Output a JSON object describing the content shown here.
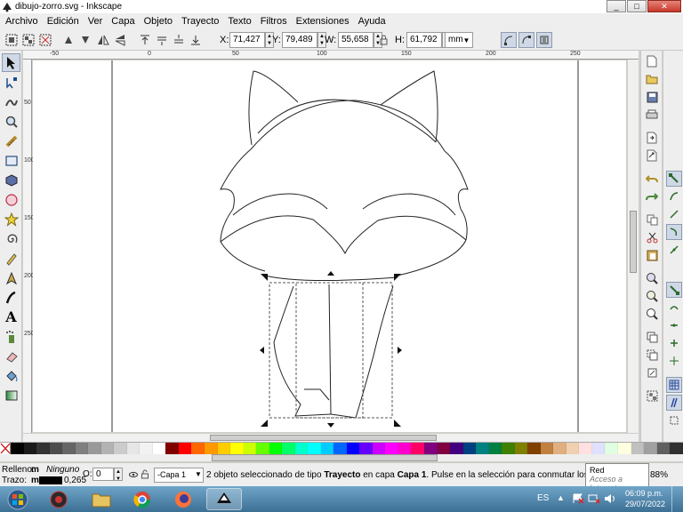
{
  "window": {
    "title": "dibujo-zorro.svg - Inkscape",
    "minimize": "_",
    "maximize": "□",
    "close": "✕"
  },
  "menu": [
    "Archivo",
    "Edición",
    "Ver",
    "Capa",
    "Objeto",
    "Trayecto",
    "Texto",
    "Filtros",
    "Extensiones",
    "Ayuda"
  ],
  "toolbar": {
    "x_label": "X:",
    "x_value": "71,427",
    "y_label": "Y:",
    "y_value": "79,489",
    "w_label": "W:",
    "w_value": "55,658",
    "h_label": "H:",
    "h_value": "61,792",
    "unit": "mm"
  },
  "status": {
    "fill_label": "Relleno:",
    "fill_flag": "m",
    "fill_value": "Ninguno",
    "stroke_label": "Trazo:",
    "stroke_flag": "m",
    "stroke_width": "0,265",
    "opacity_label": "O:",
    "opacity_value": "0",
    "layer": "-Capa 1",
    "message_a": "2 objeto seleccionado de tipo ",
    "message_b": "Trayecto",
    "message_c": " en capa ",
    "message_d": "Capa 1",
    "message_e": ". Pulse en la selección para conmutar los tiradores d...",
    "zoom": "88%"
  },
  "tooltip": {
    "title": "Red",
    "subtitle": "Acceso a Internet"
  },
  "taskbar": {
    "lang": "ES",
    "time": "06:09 p.m.",
    "date": "29/07/2022"
  },
  "colors": {
    "palette": [
      "#000000",
      "#1a1a1a",
      "#333333",
      "#4d4d4d",
      "#666666",
      "#808080",
      "#999999",
      "#b3b3b3",
      "#cccccc",
      "#e6e6e6",
      "#f2f2f2",
      "#ffffff",
      "#800000",
      "#ff0000",
      "#ff6600",
      "#ff9900",
      "#ffcc00",
      "#ffff00",
      "#ccff00",
      "#66ff00",
      "#00ff00",
      "#00ff66",
      "#00ffcc",
      "#00ffff",
      "#00ccff",
      "#0066ff",
      "#0000ff",
      "#6600ff",
      "#cc00ff",
      "#ff00ff",
      "#ff00cc",
      "#ff0066",
      "#800080",
      "#800040",
      "#400080",
      "#004080",
      "#008080",
      "#008040",
      "#408000",
      "#808000",
      "#804000",
      "#c08040",
      "#e0b080",
      "#f0d0b0",
      "#ffe0e0",
      "#e0e0ff",
      "#e0ffe0",
      "#ffffe0",
      "#c0c0c0",
      "#a0a0a0",
      "#606060",
      "#303030"
    ]
  },
  "ruler_labels": {
    "h": [
      "-50",
      "0",
      "50",
      "100",
      "150",
      "200",
      "250"
    ],
    "v": [
      "50",
      "100",
      "150",
      "200",
      "250"
    ]
  }
}
